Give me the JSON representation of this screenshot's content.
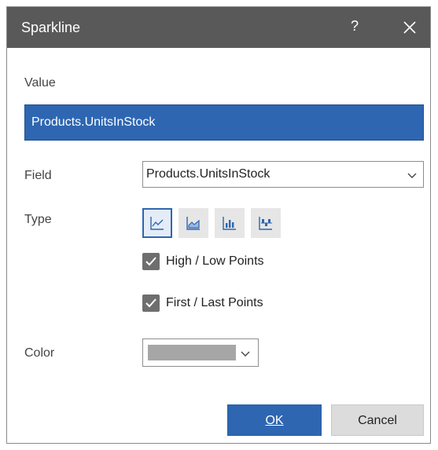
{
  "window": {
    "title": "Sparkline",
    "help_label": "?",
    "close_icon": "close-icon"
  },
  "value_section": {
    "label": "Value",
    "selected_value": "Products.UnitsInStock"
  },
  "field": {
    "label": "Field",
    "selected": "Products.UnitsInStock"
  },
  "type": {
    "label": "Type",
    "options": [
      {
        "icon": "line-sparkline-icon",
        "selected": true
      },
      {
        "icon": "area-sparkline-icon",
        "selected": false
      },
      {
        "icon": "bar-sparkline-icon",
        "selected": false
      },
      {
        "icon": "win-loss-sparkline-icon",
        "selected": false
      }
    ]
  },
  "checkboxes": {
    "high_low": {
      "label": "High / Low Points",
      "checked": true
    },
    "first_last": {
      "label": "First / Last Points",
      "checked": true
    }
  },
  "color": {
    "label": "Color",
    "selected_hex": "#a6a6a6"
  },
  "buttons": {
    "ok_label": "OK",
    "cancel_label": "Cancel"
  },
  "colors": {
    "titlebar": "#595959",
    "accent": "#2e66b1",
    "checkbox": "#6e6e6e"
  }
}
